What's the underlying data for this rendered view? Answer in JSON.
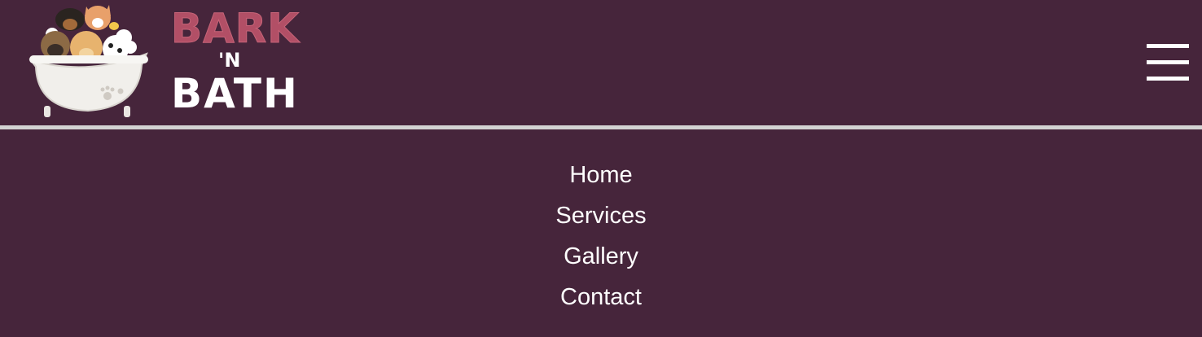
{
  "brand": {
    "line1": "BARK",
    "line2": "'N",
    "line3": "BATH"
  },
  "menu_button": {
    "icon": "hamburger-menu-icon"
  },
  "nav": {
    "items": [
      {
        "label": "Home"
      },
      {
        "label": "Services"
      },
      {
        "label": "Gallery"
      },
      {
        "label": "Contact"
      }
    ]
  },
  "colors": {
    "background": "#46253b",
    "brand_accent": "#b24f66",
    "divider": "#d3d3d3",
    "text": "#ffffff"
  }
}
